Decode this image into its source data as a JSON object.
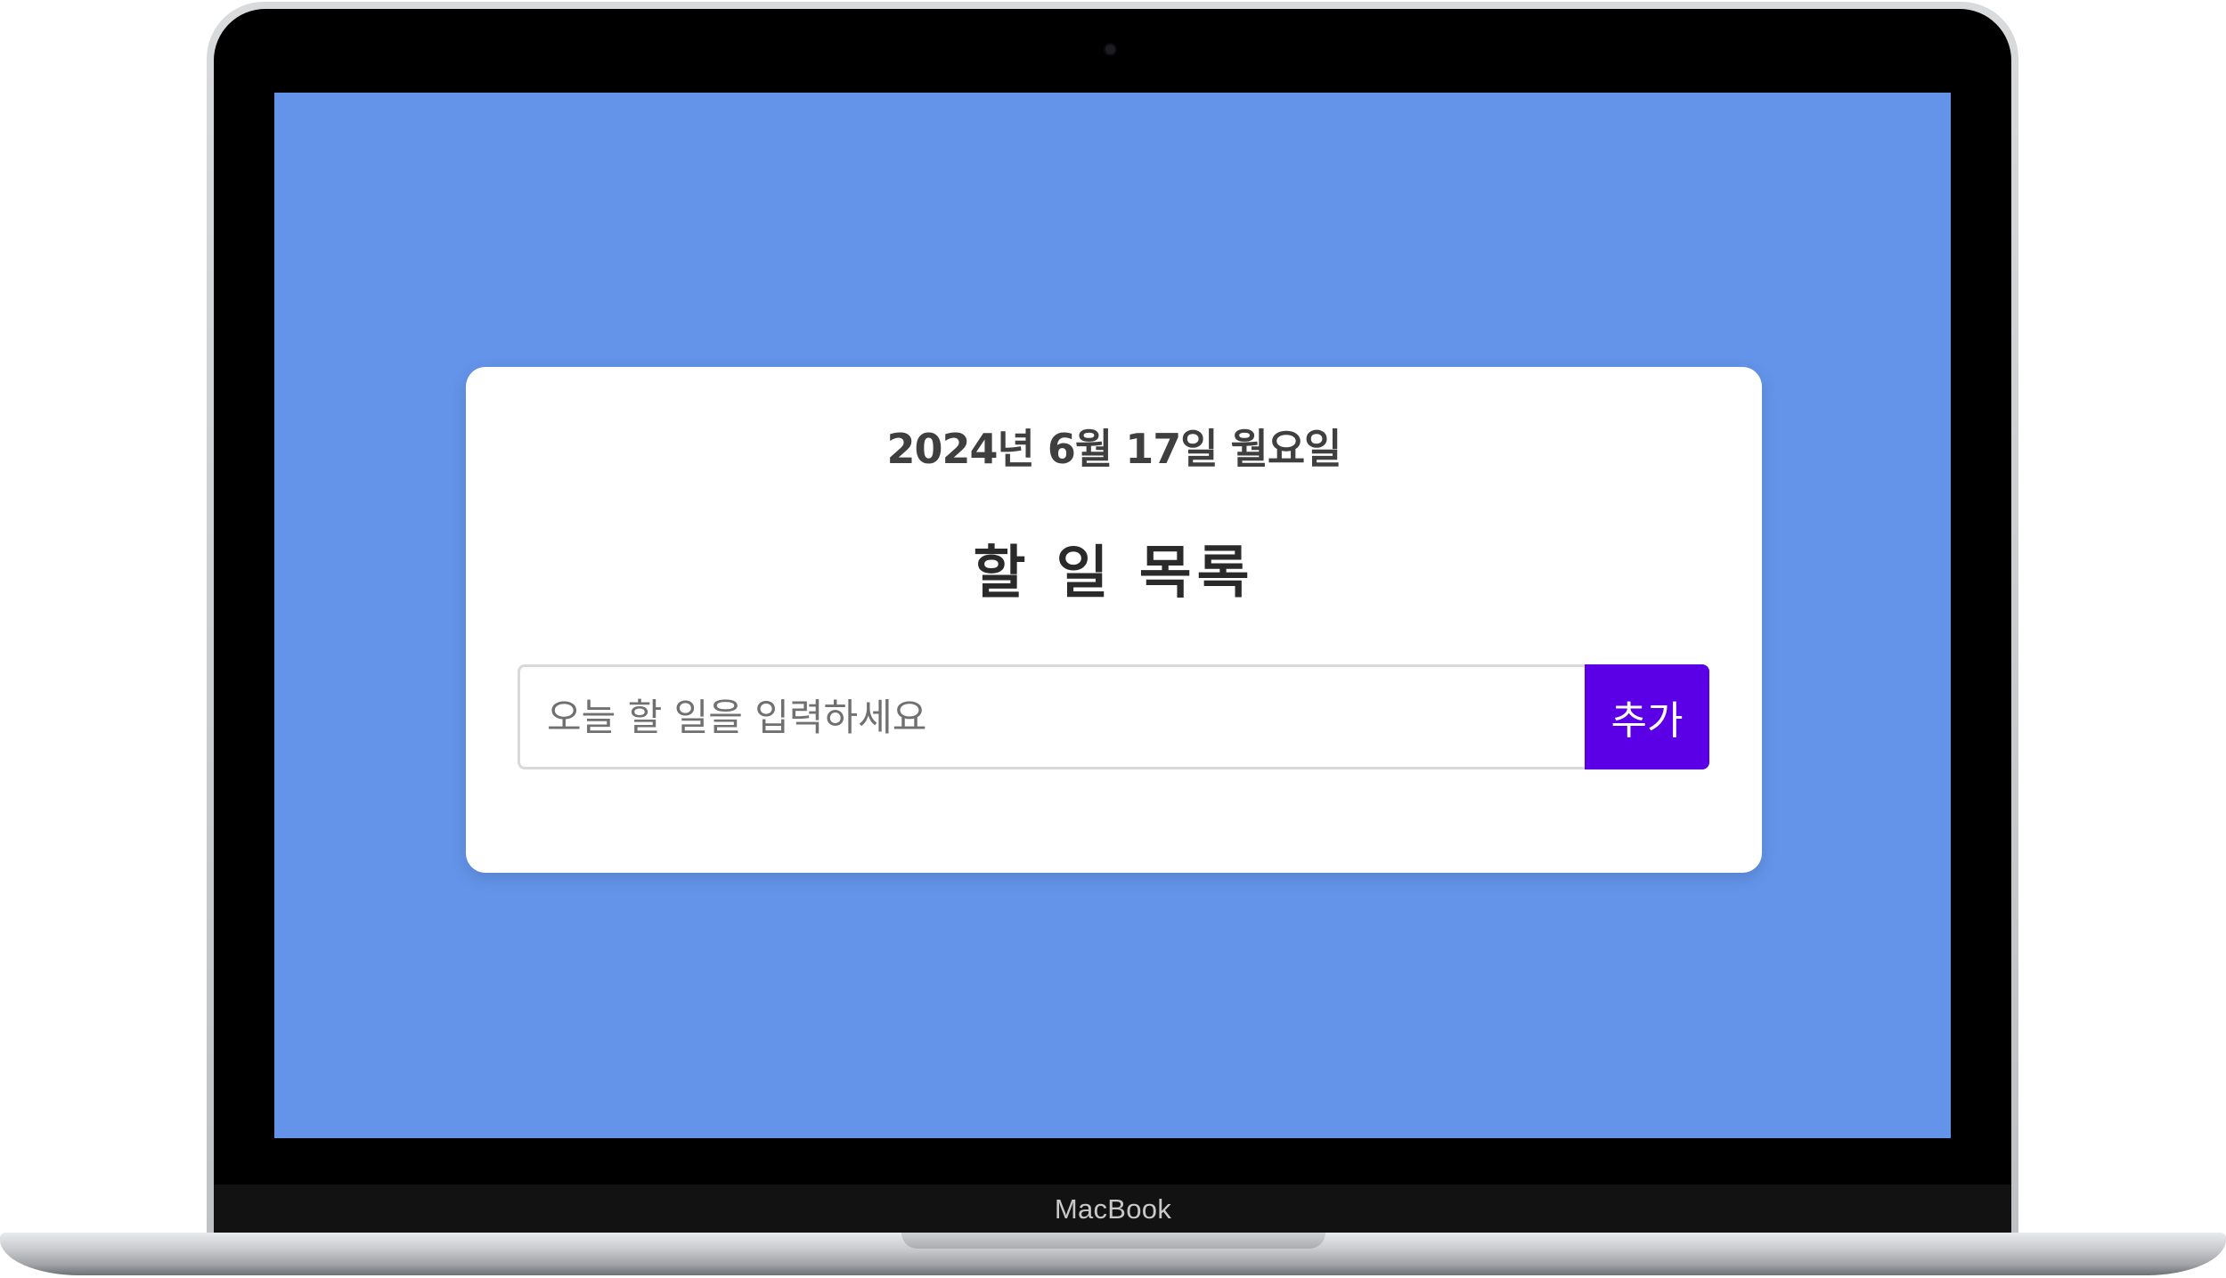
{
  "device": {
    "brand_label": "MacBook"
  },
  "app": {
    "date_text": "2024년 6월 17일 월요일",
    "title": "할 일 목록",
    "todo_input": {
      "value": "",
      "placeholder": "오늘 할 일을 입력하세요"
    },
    "add_button_label": "추가",
    "colors": {
      "page_background": "#6394e9",
      "card_background": "#ffffff",
      "add_button": "#5b00e6"
    }
  }
}
